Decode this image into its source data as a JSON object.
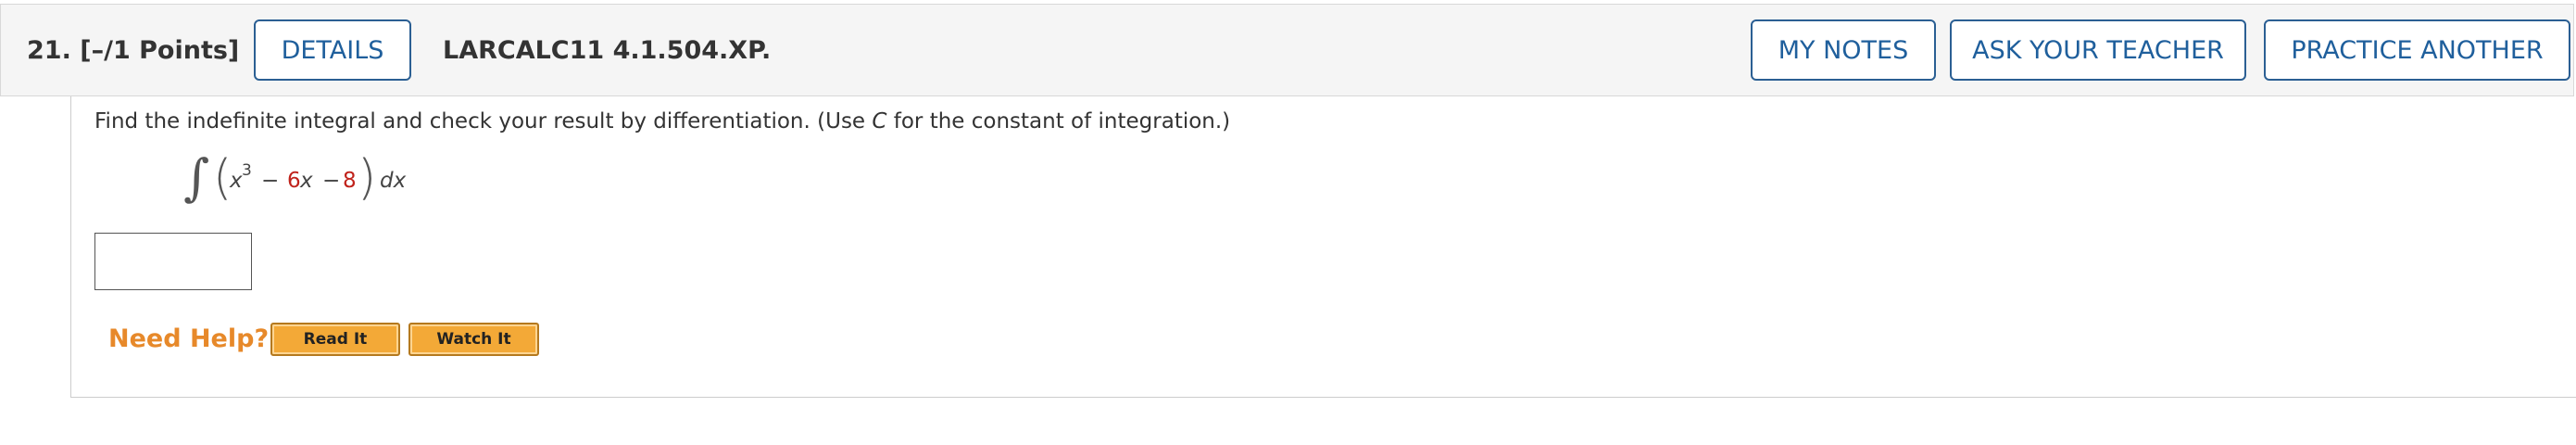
{
  "header": {
    "question_number": "21.",
    "points": "[–/1 Points]",
    "details_label": "DETAILS",
    "course_code": "LARCALC11 4.1.504.XP.",
    "my_notes_label": "MY NOTES",
    "ask_teacher_label": "ASK YOUR TEACHER",
    "practice_another_label": "PRACTICE ANOTHER"
  },
  "question": {
    "instruction_before": "Find the indefinite integral and check your result by differentiation. (Use ",
    "instruction_var": "C",
    "instruction_after": " for the constant of integration.)",
    "integral": {
      "sign": "∫",
      "open_paren": "(",
      "var1": "x",
      "exponent": "3",
      "minus1": "−",
      "coef": "6",
      "var2": "x",
      "minus2": "−",
      "constant": "8",
      "close_paren": ")",
      "differential": "dx"
    },
    "answer_value": ""
  },
  "help": {
    "label": "Need Help?",
    "read_it": "Read It",
    "watch_it": "Watch It"
  },
  "colors": {
    "button_text": "#1f5f9c",
    "highlight_red": "#c0221b",
    "need_help_orange": "#e7892a",
    "help_button_bg": "#f3a937"
  }
}
